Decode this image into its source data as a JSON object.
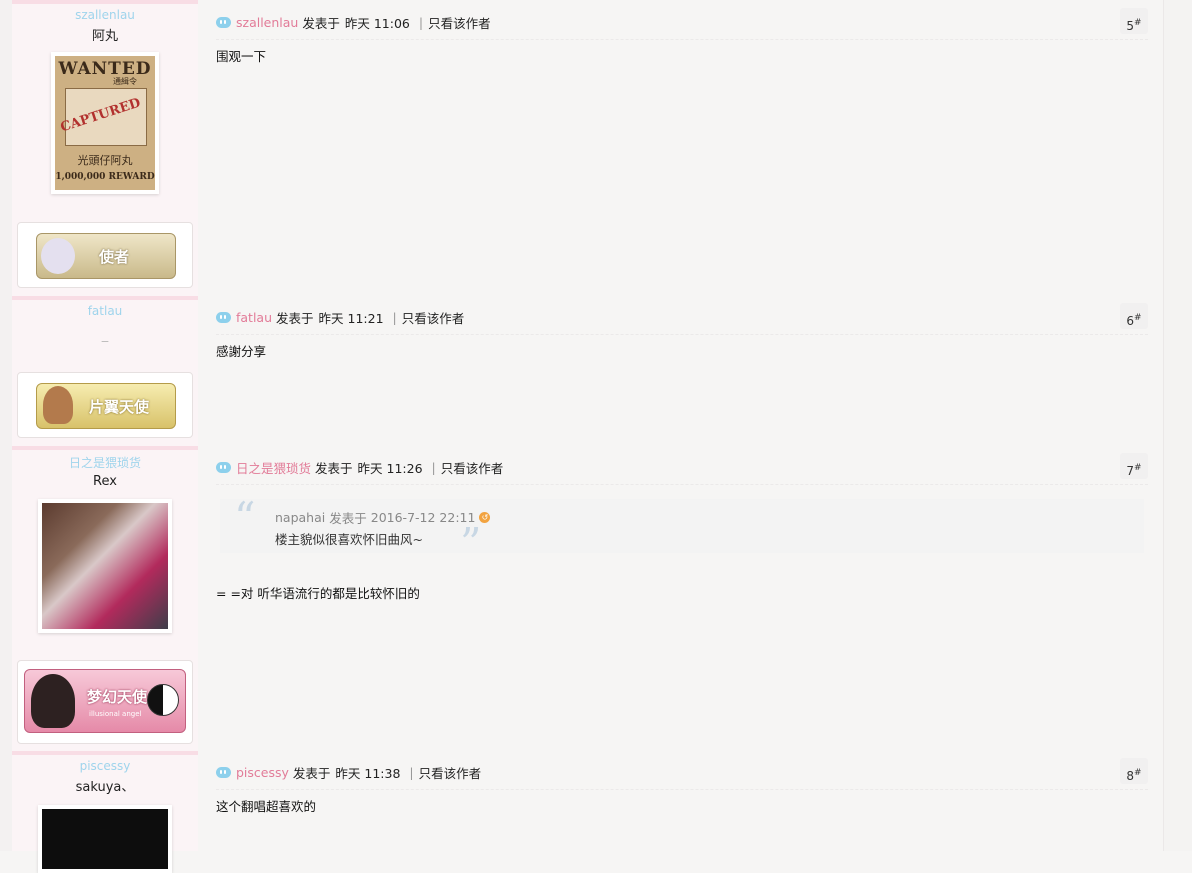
{
  "common": {
    "posted_label": "发表于",
    "only_author": "只看该作者"
  },
  "posts": [
    {
      "author": "szallenlau",
      "user_title": "阿丸",
      "avatar_text": [
        "WANTED",
        "通緝令",
        "CAPTURED",
        "光頭仔阿丸",
        "1,000,000 REWARD"
      ],
      "medal_text": "使者",
      "time": "昨天 11:06",
      "floor": "5",
      "body": "围观一下"
    },
    {
      "author": "fatlau",
      "user_title": "_",
      "medal_text": "片翼天使",
      "time": "昨天 11:21",
      "floor": "6",
      "body": "感謝分享"
    },
    {
      "author": "日之是猥琐货",
      "user_title": "Rex",
      "medal_text": "梦幻天使",
      "medal_subtext": "illusional angel",
      "time": "昨天 11:26",
      "floor": "7",
      "quote": {
        "author": "napahai",
        "time": "2016-7-12 22:11",
        "text": "楼主貌似很喜欢怀旧曲风~"
      },
      "body": "= =对   听华语流行的都是比较怀旧的"
    },
    {
      "author": "piscessy",
      "user_title": "sakuya、",
      "time": "昨天 11:38",
      "floor": "8",
      "body": "这个翻唱超喜欢的"
    }
  ],
  "colors": {
    "author_link": "#e27b98",
    "sidebar_name": "#9fd4ec",
    "sidebar_bg": "#fbf4f6"
  }
}
